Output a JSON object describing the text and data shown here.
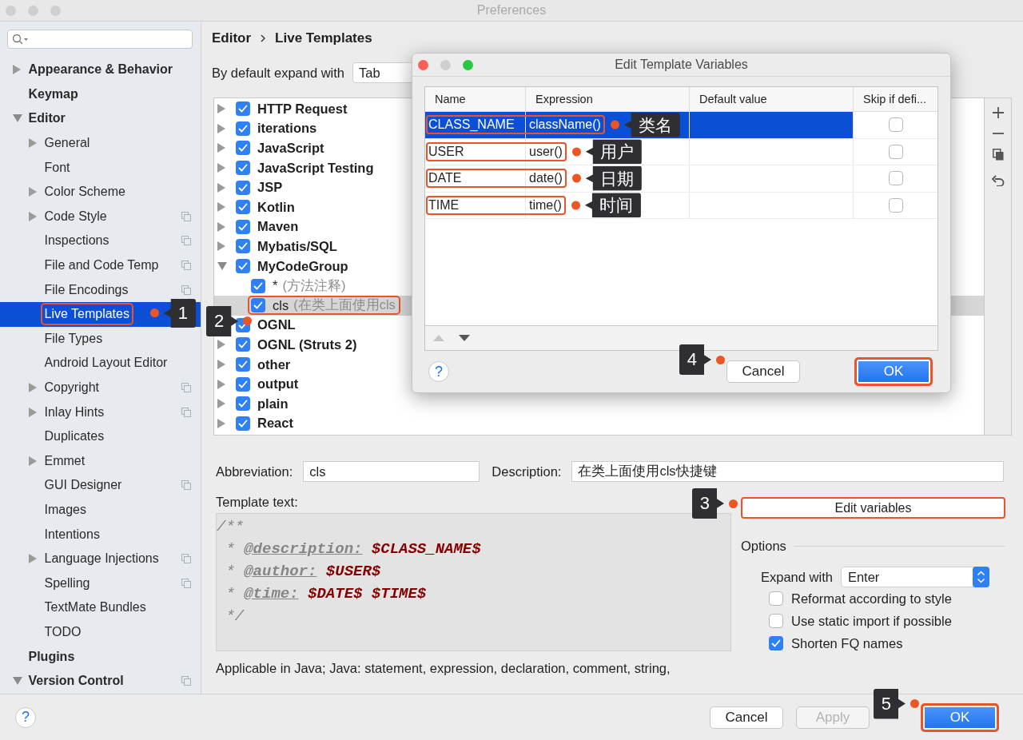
{
  "window": {
    "title": "Preferences"
  },
  "sidebar": {
    "items": [
      {
        "label": "Appearance & Behavior",
        "selected": false,
        "expanded": false
      },
      {
        "label": "Keymap",
        "selected": false
      },
      {
        "label": "Editor",
        "selected": false,
        "expanded": true,
        "children": [
          {
            "label": "General",
            "selected": false,
            "expanded": false
          },
          {
            "label": "Font",
            "selected": false
          },
          {
            "label": "Color Scheme",
            "selected": false,
            "expanded": false
          },
          {
            "label": "Code Style",
            "selected": false,
            "expanded": false,
            "copy_icon": true
          },
          {
            "label": "Inspections",
            "selected": false,
            "copy_icon": true
          },
          {
            "label": "File and Code Temp",
            "selected": false,
            "copy_icon": true
          },
          {
            "label": "File Encodings",
            "selected": false,
            "copy_icon": true
          },
          {
            "label": "Live Templates",
            "selected": true,
            "outlined": true,
            "callout": "1"
          },
          {
            "label": "File Types",
            "selected": false
          },
          {
            "label": "Android Layout Editor",
            "selected": false
          },
          {
            "label": "Copyright",
            "selected": false,
            "expanded": false,
            "copy_icon": true
          },
          {
            "label": "Inlay Hints",
            "selected": false,
            "expanded": false,
            "copy_icon": true
          },
          {
            "label": "Duplicates",
            "selected": false
          },
          {
            "label": "Emmet",
            "selected": false,
            "expanded": false
          },
          {
            "label": "GUI Designer",
            "selected": false,
            "copy_icon": true
          },
          {
            "label": "Images",
            "selected": false
          },
          {
            "label": "Intentions",
            "selected": false
          },
          {
            "label": "Language Injections",
            "selected": false,
            "expanded": false,
            "copy_icon": true
          },
          {
            "label": "Spelling",
            "selected": false,
            "copy_icon": true
          },
          {
            "label": "TextMate Bundles",
            "selected": false
          },
          {
            "label": "TODO",
            "selected": false
          }
        ]
      },
      {
        "label": "Plugins",
        "selected": false
      },
      {
        "label": "Version Control",
        "selected": false,
        "expanded": true,
        "copy_icon": true
      }
    ]
  },
  "breadcrumb": [
    "Editor",
    "Live Templates"
  ],
  "expand_default": {
    "label": "By default expand with",
    "value": "Tab"
  },
  "templates": {
    "groups": [
      {
        "name": "HTTP Request",
        "checked": true,
        "expanded": false,
        "selected": false
      },
      {
        "name": "iterations",
        "checked": true,
        "expanded": false,
        "selected": false
      },
      {
        "name": "JavaScript",
        "checked": true,
        "expanded": false,
        "selected": false
      },
      {
        "name": "JavaScript Testing",
        "checked": true,
        "expanded": false,
        "selected": false
      },
      {
        "name": "JSP",
        "checked": true,
        "expanded": false,
        "selected": false
      },
      {
        "name": "Kotlin",
        "checked": true,
        "expanded": false,
        "selected": false
      },
      {
        "name": "Maven",
        "checked": true,
        "expanded": false,
        "selected": false
      },
      {
        "name": "Mybatis/SQL",
        "checked": true,
        "expanded": false,
        "selected": false
      },
      {
        "name": "MyCodeGroup",
        "checked": true,
        "expanded": true,
        "selected": false,
        "children": [
          {
            "abbreviation": "*",
            "description": "(方法注释)",
            "checked": true,
            "selected": false
          },
          {
            "abbreviation": "cls",
            "description": "(在类上面使用cls",
            "checked": true,
            "selected": true,
            "outlined": true,
            "callout": "2"
          }
        ]
      },
      {
        "name": "OGNL",
        "checked": true,
        "selected": false
      },
      {
        "name": "OGNL (Struts 2)",
        "checked": true,
        "expanded": false,
        "selected": false
      },
      {
        "name": "other",
        "checked": true,
        "expanded": false,
        "selected": false
      },
      {
        "name": "output",
        "checked": true,
        "expanded": false,
        "selected": false
      },
      {
        "name": "plain",
        "checked": true,
        "expanded": false,
        "selected": false
      },
      {
        "name": "React",
        "checked": true,
        "expanded": false,
        "selected": false
      }
    ]
  },
  "abbreviation": {
    "label": "Abbreviation:",
    "value": "cls"
  },
  "description": {
    "label": "Description:",
    "value": "在类上面使用cls快捷键"
  },
  "template_text": {
    "label": "Template text:",
    "lines": [
      [
        {
          "kind": "comment",
          "text": "/**"
        }
      ],
      [
        {
          "kind": "comment",
          "text": " * "
        },
        {
          "kind": "tag",
          "text": "@description:"
        },
        {
          "kind": "variable",
          "text": " $CLASS_NAME$"
        }
      ],
      [
        {
          "kind": "comment",
          "text": " * "
        },
        {
          "kind": "tag",
          "text": "@author:"
        },
        {
          "kind": "variable",
          "text": " $USER$"
        }
      ],
      [
        {
          "kind": "comment",
          "text": " * "
        },
        {
          "kind": "tag",
          "text": "@time:"
        },
        {
          "kind": "variable",
          "text": " $DATE$ $TIME$"
        }
      ],
      [
        {
          "kind": "comment",
          "text": " */"
        }
      ]
    ]
  },
  "applicable": "Applicable in Java; Java: statement, expression, declaration, comment, string,",
  "edit_variables": {
    "label": "Edit variables",
    "outlined": true,
    "callout": "3"
  },
  "options": {
    "title": "Options",
    "expand_with": {
      "label": "Expand with",
      "value": "Enter"
    },
    "checkboxes": [
      {
        "label": "Reformat according to style",
        "checked": false
      },
      {
        "label": "Use static import if possible",
        "checked": false
      },
      {
        "label": "Shorten FQ names",
        "checked": true
      }
    ]
  },
  "footer": {
    "help": "?",
    "buttons": [
      {
        "label": "Cancel",
        "default": false,
        "disabled": false
      },
      {
        "label": "Apply",
        "default": false,
        "disabled": true
      },
      {
        "label": "OK",
        "default": true,
        "disabled": false,
        "outlined": true,
        "callout": "5"
      }
    ]
  },
  "dialog": {
    "title": "Edit Template Variables",
    "columns": [
      "Name",
      "Expression",
      "Default value",
      "Skip if defi..."
    ],
    "rows": [
      {
        "name": "CLASS_NAME",
        "expression": "className()",
        "skip_if_defined": false,
        "selected": true,
        "outlined": true,
        "callout": "类名"
      },
      {
        "name": "USER",
        "expression": "user()",
        "skip_if_defined": false,
        "selected": false,
        "outlined": true,
        "callout": "用户"
      },
      {
        "name": "DATE",
        "expression": "date()",
        "skip_if_defined": false,
        "selected": false,
        "outlined": true,
        "callout": "日期"
      },
      {
        "name": "TIME",
        "expression": "time()",
        "skip_if_defined": false,
        "selected": false,
        "outlined": true,
        "callout": "时间"
      }
    ],
    "help": "?",
    "buttons": [
      {
        "label": "Cancel",
        "default": false,
        "outlined": false,
        "callout": "4"
      },
      {
        "label": "OK",
        "default": true,
        "outlined": true
      }
    ]
  }
}
